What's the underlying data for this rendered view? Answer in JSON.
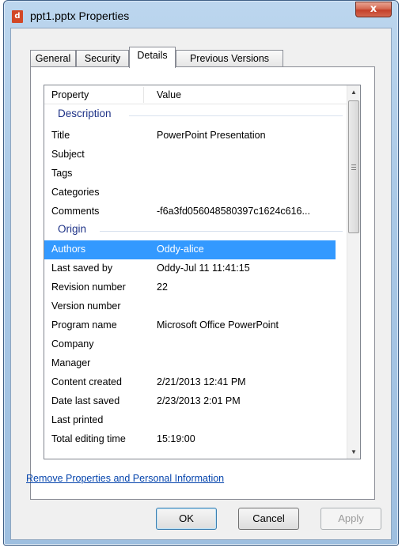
{
  "window": {
    "title": "ppt1.pptx Properties",
    "close_label": "x",
    "app_icon_letter": "d"
  },
  "tabs": [
    {
      "label": "General"
    },
    {
      "label": "Security"
    },
    {
      "label": "Details",
      "active": true
    },
    {
      "label": "Previous Versions"
    }
  ],
  "list": {
    "headers": {
      "property": "Property",
      "value": "Value"
    },
    "groups": {
      "description": "Description",
      "origin": "Origin"
    },
    "rows": [
      {
        "property": "Title",
        "value": "PowerPoint Presentation"
      },
      {
        "property": "Subject",
        "value": ""
      },
      {
        "property": "Tags",
        "value": ""
      },
      {
        "property": "Categories",
        "value": ""
      },
      {
        "property": "Comments",
        "value": "-f6a3fd056048580397c1624c616..."
      },
      {
        "property": "Authors",
        "value": "Oddy-alice"
      },
      {
        "property": "Last saved by",
        "value": "Oddy-Jul 11 11:41:15"
      },
      {
        "property": "Revision number",
        "value": "22"
      },
      {
        "property": "Version number",
        "value": ""
      },
      {
        "property": "Program name",
        "value": "Microsoft Office PowerPoint"
      },
      {
        "property": "Company",
        "value": ""
      },
      {
        "property": "Manager",
        "value": ""
      },
      {
        "property": "Content created",
        "value": "2/21/2013 12:41 PM"
      },
      {
        "property": "Date last saved",
        "value": "2/23/2013 2:01 PM"
      },
      {
        "property": "Last printed",
        "value": ""
      },
      {
        "property": "Total editing time",
        "value": "15:19:00"
      }
    ],
    "selected_property": "Authors"
  },
  "link_text": "Remove Properties and Personal Information",
  "buttons": {
    "ok": "OK",
    "cancel": "Cancel",
    "apply": "Apply"
  },
  "colors": {
    "selection": "#3399ff",
    "group_header": "#1e3287",
    "link": "#0645ad"
  }
}
